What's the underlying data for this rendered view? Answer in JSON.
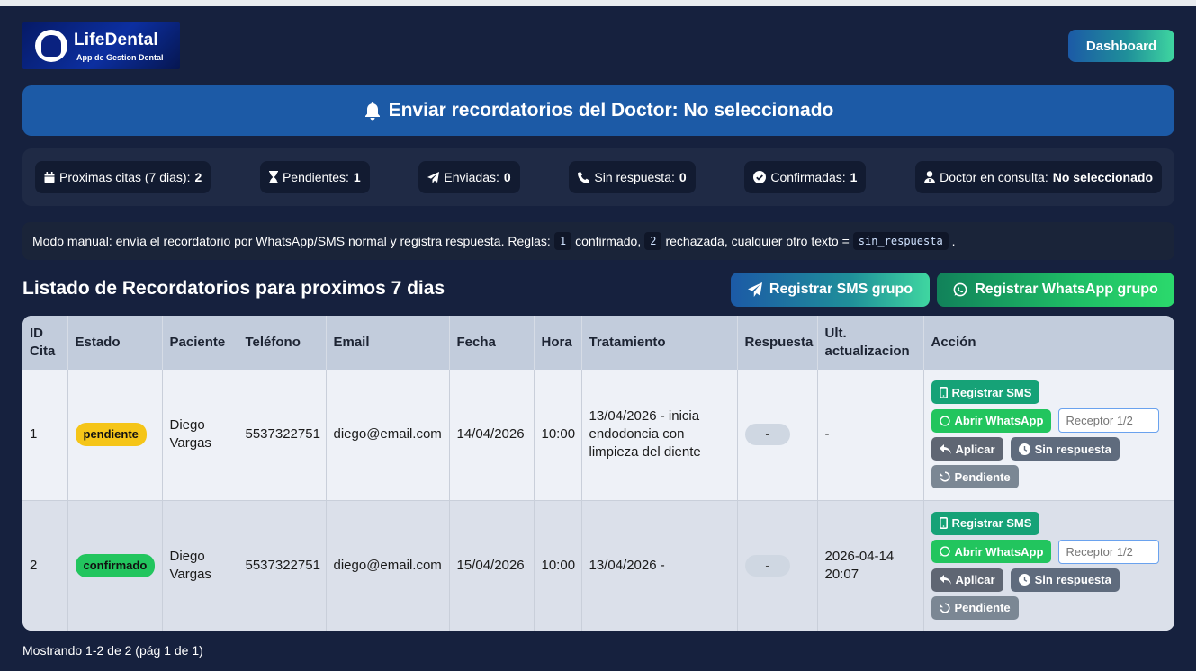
{
  "header": {
    "logo_title": "LifeDental",
    "logo_subtitle": "App de Gestion Dental",
    "dashboard_label": "Dashboard"
  },
  "banner": {
    "text": "Enviar recordatorios del Doctor: No seleccionado"
  },
  "stats": [
    {
      "icon": "calendar-icon",
      "label": "Proximas citas (7 dias):",
      "value": "2"
    },
    {
      "icon": "hourglass-icon",
      "label": "Pendientes:",
      "value": "1"
    },
    {
      "icon": "send-icon",
      "label": "Enviadas:",
      "value": "0"
    },
    {
      "icon": "phone-icon",
      "label": "Sin respuesta:",
      "value": "0"
    },
    {
      "icon": "check-circle-icon",
      "label": "Confirmadas:",
      "value": "1"
    },
    {
      "icon": "doctor-icon",
      "label": "Doctor en consulta:",
      "value": "No seleccionado"
    }
  ],
  "notice": {
    "text1": "Modo manual: envía el recordatorio por WhatsApp/SMS normal y registra respuesta. Reglas:",
    "code1": "1",
    "text2": "confirmado,",
    "code2": "2",
    "text3": "rechazada, cualquier otro texto =",
    "code3": "sin_respuesta",
    "text4": "."
  },
  "list": {
    "title": "Listado de Recordatorios para proximos 7 dias",
    "sms_group_label": "Registrar SMS grupo",
    "wa_group_label": "Registrar WhatsApp grupo"
  },
  "table": {
    "headers": [
      "ID Cita",
      "Estado",
      "Paciente",
      "Teléfono",
      "Email",
      "Fecha",
      "Hora",
      "Tratamiento",
      "Respuesta",
      "Ult. actualizacion",
      "Acción"
    ],
    "rows": [
      {
        "id": "1",
        "estado": "pendiente",
        "paciente": "Diego Vargas",
        "telefono": "5537322751",
        "email": "diego@email.com",
        "fecha": "14/04/2026",
        "hora": "10:00",
        "tratamiento": "13/04/2026 - inicia endodoncia con limpieza del diente",
        "respuesta": "-",
        "ult": "-"
      },
      {
        "id": "2",
        "estado": "confirmado",
        "paciente": "Diego Vargas",
        "telefono": "5537322751",
        "email": "diego@email.com",
        "fecha": "15/04/2026",
        "hora": "10:00",
        "tratamiento": "13/04/2026 -",
        "respuesta": "-",
        "ult": "2026-04-14 20:07"
      }
    ]
  },
  "actions": {
    "sms": "Registrar SMS",
    "wa": "Abrir WhatsApp",
    "receptor_placeholder": "Receptor 1/2",
    "aplicar": "Aplicar",
    "sin_respuesta": "Sin respuesta",
    "pendiente": "Pendiente"
  },
  "footer": {
    "text": "Mostrando 1-2 de 2 (pág 1 de 1)"
  },
  "colors": {
    "background": "#16213e",
    "banner": "#1c5aa6",
    "pending": "#f5c518",
    "confirmed": "#22c55e"
  }
}
